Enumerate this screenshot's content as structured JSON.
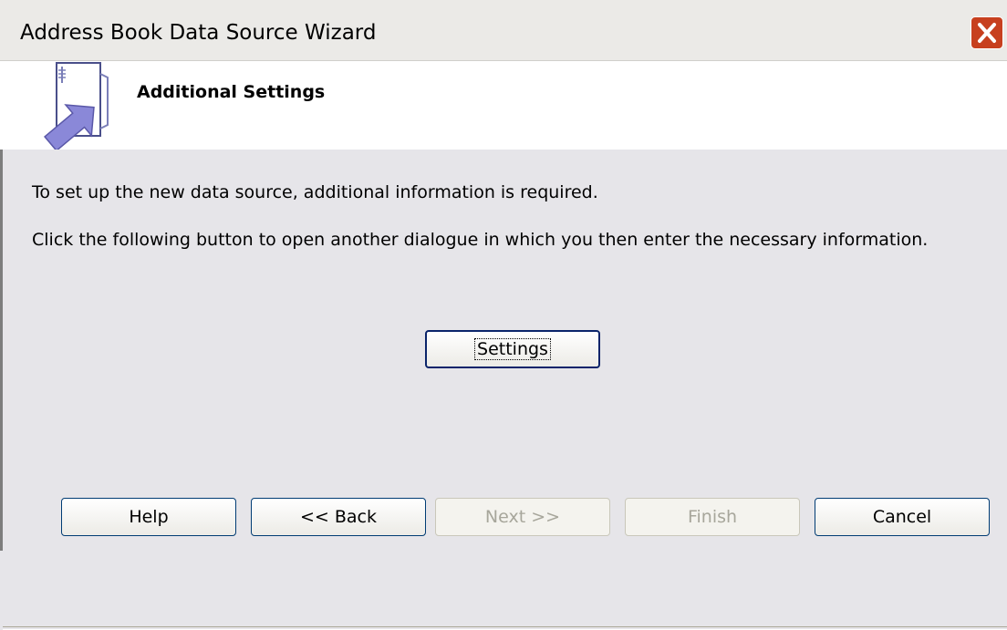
{
  "window": {
    "title": "Address Book Data Source Wizard"
  },
  "header": {
    "title": "Additional Settings"
  },
  "body": {
    "line1": "To set up the new data source, additional information is required.",
    "line2": "Click the following button to open another dialogue in which you then enter the necessary information.",
    "settings_button": "Settings"
  },
  "footer": {
    "help": "Help",
    "back": "<< Back",
    "next": "Next >>",
    "finish": "Finish",
    "cancel": "Cancel"
  },
  "colors": {
    "dialog_bg": "#e6e5e9",
    "close_button": "#c7401f",
    "focus_border": "#0a246a",
    "disabled_text": "#a7a69b"
  }
}
